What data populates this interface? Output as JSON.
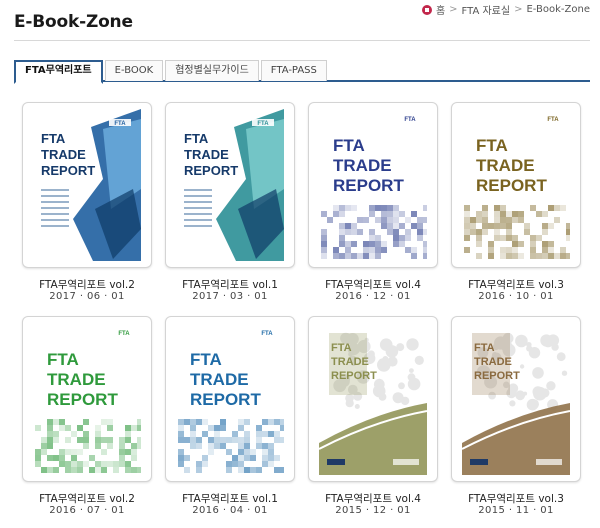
{
  "page": {
    "title": "E-Book-Zone"
  },
  "breadcrumb": {
    "home": "홈",
    "section": "FTA 자료실",
    "current": "E-Book-Zone",
    "separator": ">"
  },
  "tabs": [
    {
      "label": "FTA무역리포트",
      "active": true
    },
    {
      "label": "E-BOOK",
      "active": false
    },
    {
      "label": "협정별실무가이드",
      "active": false
    },
    {
      "label": "FTA-PASS",
      "active": false
    }
  ],
  "books": [
    {
      "title": "FTA무역리포트 vol.2",
      "date": "2017 · 06 · 01",
      "style": "diagonal-blue",
      "cover": {
        "line1": "FTA",
        "line2": "TRADE",
        "line3": "REPORT",
        "logo": "FTA"
      }
    },
    {
      "title": "FTA무역리포트 vol.1",
      "date": "2017 · 03 · 01",
      "style": "diagonal-teal",
      "cover": {
        "line1": "FTA",
        "line2": "TRADE",
        "line3": "REPORT",
        "logo": "FTA"
      }
    },
    {
      "title": "FTA무역리포트 vol.4",
      "date": "2016 · 12 · 01",
      "style": "pixel-purple",
      "cover": {
        "line1": "FTA",
        "line2": "TRADE",
        "line3": "REPORT",
        "logo": "FTA"
      }
    },
    {
      "title": "FTA무역리포트 vol.3",
      "date": "2016 · 10 · 01",
      "style": "pixel-gold",
      "cover": {
        "line1": "FTA",
        "line2": "TRADE",
        "line3": "REPORT",
        "logo": "FTA"
      }
    },
    {
      "title": "FTA무역리포트 vol.2",
      "date": "2016 · 07 · 01",
      "style": "pixel-green",
      "cover": {
        "line1": "FTA",
        "line2": "TRADE",
        "line3": "REPORT",
        "logo": "FTA"
      }
    },
    {
      "title": "FTA무역리포트 vol.1",
      "date": "2016 · 04 · 01",
      "style": "pixel-aqua",
      "cover": {
        "line1": "FTA",
        "line2": "TRADE",
        "line3": "REPORT",
        "logo": "FTA"
      }
    },
    {
      "title": "FTA무역리포트 vol.4",
      "date": "2015 · 12 · 01",
      "style": "map-olive",
      "cover": {
        "line1": "FTA",
        "line2": "TRADE",
        "line3": "REPORT",
        "logo": ""
      }
    },
    {
      "title": "FTA무역리포트 vol.3",
      "date": "2015 · 11 · 01",
      "style": "map-brown",
      "cover": {
        "line1": "FTA",
        "line2": "TRADE",
        "line3": "REPORT",
        "logo": ""
      }
    }
  ],
  "colors": {
    "tab_accent": "#2d5c8f",
    "diagonal-blue": "#1f5fa0",
    "diagonal-teal": "#2b8f96",
    "pixel-purple": "#2b3d8c",
    "pixel-gold": "#7a6320",
    "pixel-green": "#2f9a3c",
    "pixel-aqua": "#1e6aa6",
    "map-olive": "#8c8f4f",
    "map-brown": "#8a6a3f"
  }
}
